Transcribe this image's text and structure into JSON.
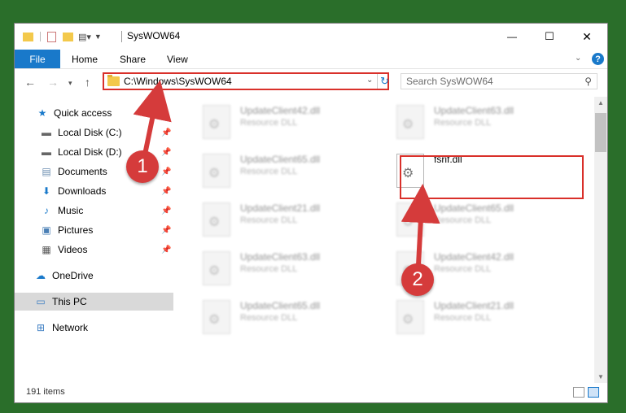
{
  "window": {
    "title": "SysWOW64",
    "controls": {
      "minimize": "—",
      "maximize": "☐",
      "close": "✕"
    }
  },
  "ribbon": {
    "tabs": [
      "File",
      "Home",
      "Share",
      "View"
    ],
    "help": "?"
  },
  "address": {
    "path": "C:\\Windows\\SysWOW64",
    "search_placeholder": "Search SysWOW64"
  },
  "sidebar": {
    "quick_access": "Quick access",
    "items": [
      {
        "label": "Local Disk (C:)",
        "icon": "drive-icon",
        "pinned": true
      },
      {
        "label": "Local Disk (D:)",
        "icon": "drive-icon",
        "pinned": true
      },
      {
        "label": "Documents",
        "icon": "documents-icon",
        "pinned": true
      },
      {
        "label": "Downloads",
        "icon": "downloads-icon",
        "pinned": true
      },
      {
        "label": "Music",
        "icon": "music-icon",
        "pinned": true
      },
      {
        "label": "Pictures",
        "icon": "pictures-icon",
        "pinned": true
      },
      {
        "label": "Videos",
        "icon": "videos-icon",
        "pinned": true
      }
    ],
    "onedrive": "OneDrive",
    "this_pc": "This PC",
    "network": "Network"
  },
  "files": [
    {
      "name": "UpdateClient42.dll",
      "type": "Resource DLL"
    },
    {
      "name": "UpdateClient63.dll",
      "type": "Resource DLL"
    },
    {
      "name": "UpdateClient65.dll",
      "type": "Resource DLL"
    },
    {
      "name": "fsrif.dll",
      "type": ""
    },
    {
      "name": "UpdateClient21.dll",
      "type": "Resource DLL"
    },
    {
      "name": "UpdateClient65.dll",
      "type": "Resource DLL"
    },
    {
      "name": "UpdateClient63.dll",
      "type": "Resource DLL"
    },
    {
      "name": "UpdateClient42.dll",
      "type": "Resource DLL"
    },
    {
      "name": "UpdateClient65.dll",
      "type": "Resource DLL"
    },
    {
      "name": "UpdateClient21.dll",
      "type": "Resource DLL"
    }
  ],
  "status": {
    "item_count": "191 items"
  },
  "annotations": {
    "step1": "1",
    "step2": "2",
    "color": "#d9302a"
  }
}
